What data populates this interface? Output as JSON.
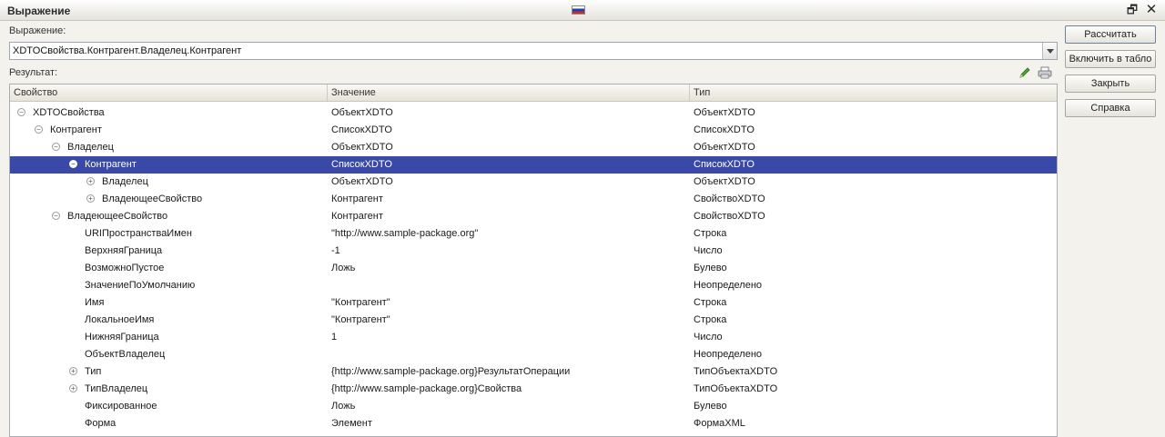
{
  "window": {
    "title": "Выражение",
    "restore_glyph": "🗗",
    "close_glyph": "✕"
  },
  "expression": {
    "label": "Выражение:",
    "value": "XDTOСвойства.Контрагент.Владелец.Контрагент"
  },
  "result": {
    "label": "Результат:"
  },
  "grid": {
    "columns": [
      "Свойство",
      "Значение",
      "Тип"
    ],
    "rows": [
      {
        "level": 0,
        "toggle": "minus",
        "name": "XDTOСвойства",
        "value": "ОбъектXDTO",
        "type": "ОбъектXDTO",
        "selected": false
      },
      {
        "level": 1,
        "toggle": "minus",
        "name": "Контрагент",
        "value": "СписокXDTO",
        "type": "СписокXDTO",
        "selected": false
      },
      {
        "level": 2,
        "toggle": "minus",
        "name": "Владелец",
        "value": "ОбъектXDTO",
        "type": "ОбъектXDTO",
        "selected": false
      },
      {
        "level": 3,
        "toggle": "minus",
        "name": "Контрагент",
        "value": "СписокXDTO",
        "type": "СписокXDTO",
        "selected": true
      },
      {
        "level": 4,
        "toggle": "plus",
        "name": "Владелец",
        "value": "ОбъектXDTO",
        "type": "ОбъектXDTO",
        "selected": false
      },
      {
        "level": 4,
        "toggle": "plus",
        "name": "ВладеющееСвойство",
        "value": "Контрагент",
        "type": "СвойствоXDTO",
        "selected": false
      },
      {
        "level": 2,
        "toggle": "minus",
        "name": "ВладеющееСвойство",
        "value": "Контрагент",
        "type": "СвойствоXDTO",
        "selected": false
      },
      {
        "level": 3,
        "toggle": "none",
        "name": "URIПространстваИмен",
        "value": "\"http://www.sample-package.org\"",
        "type": "Строка",
        "selected": false
      },
      {
        "level": 3,
        "toggle": "none",
        "name": "ВерхняяГраница",
        "value": "-1",
        "type": "Число",
        "selected": false
      },
      {
        "level": 3,
        "toggle": "none",
        "name": "ВозможноПустое",
        "value": "Ложь",
        "type": "Булево",
        "selected": false
      },
      {
        "level": 3,
        "toggle": "none",
        "name": "ЗначениеПоУмолчанию",
        "value": "",
        "type": "Неопределено",
        "selected": false
      },
      {
        "level": 3,
        "toggle": "none",
        "name": "Имя",
        "value": "\"Контрагент\"",
        "type": "Строка",
        "selected": false
      },
      {
        "level": 3,
        "toggle": "none",
        "name": "ЛокальноеИмя",
        "value": "\"Контрагент\"",
        "type": "Строка",
        "selected": false
      },
      {
        "level": 3,
        "toggle": "none",
        "name": "НижняяГраница",
        "value": "1",
        "type": "Число",
        "selected": false
      },
      {
        "level": 3,
        "toggle": "none",
        "name": "ОбъектВладелец",
        "value": "",
        "type": "Неопределено",
        "selected": false
      },
      {
        "level": 3,
        "toggle": "plus",
        "name": "Тип",
        "value": "{http://www.sample-package.org}РезультатОперации",
        "type": "ТипОбъектаXDTO",
        "selected": false
      },
      {
        "level": 3,
        "toggle": "plus",
        "name": "ТипВладелец",
        "value": "{http://www.sample-package.org}Свойства",
        "type": "ТипОбъектаXDTO",
        "selected": false
      },
      {
        "level": 3,
        "toggle": "none",
        "name": "Фиксированное",
        "value": "Ложь",
        "type": "Булево",
        "selected": false
      },
      {
        "level": 3,
        "toggle": "none",
        "name": "Форма",
        "value": "Элемент",
        "type": "ФормаXML",
        "selected": false
      }
    ]
  },
  "buttons": {
    "calculate": "Рассчитать",
    "include_in_board": "Включить в табло",
    "close": "Закрыть",
    "help": "Справка"
  },
  "icons": {
    "edit": "pencil-icon",
    "print": "print-icon",
    "flag": "russian-flag-icon"
  },
  "colors": {
    "selection": "#3a48a8",
    "background": "#f3f2ec"
  }
}
